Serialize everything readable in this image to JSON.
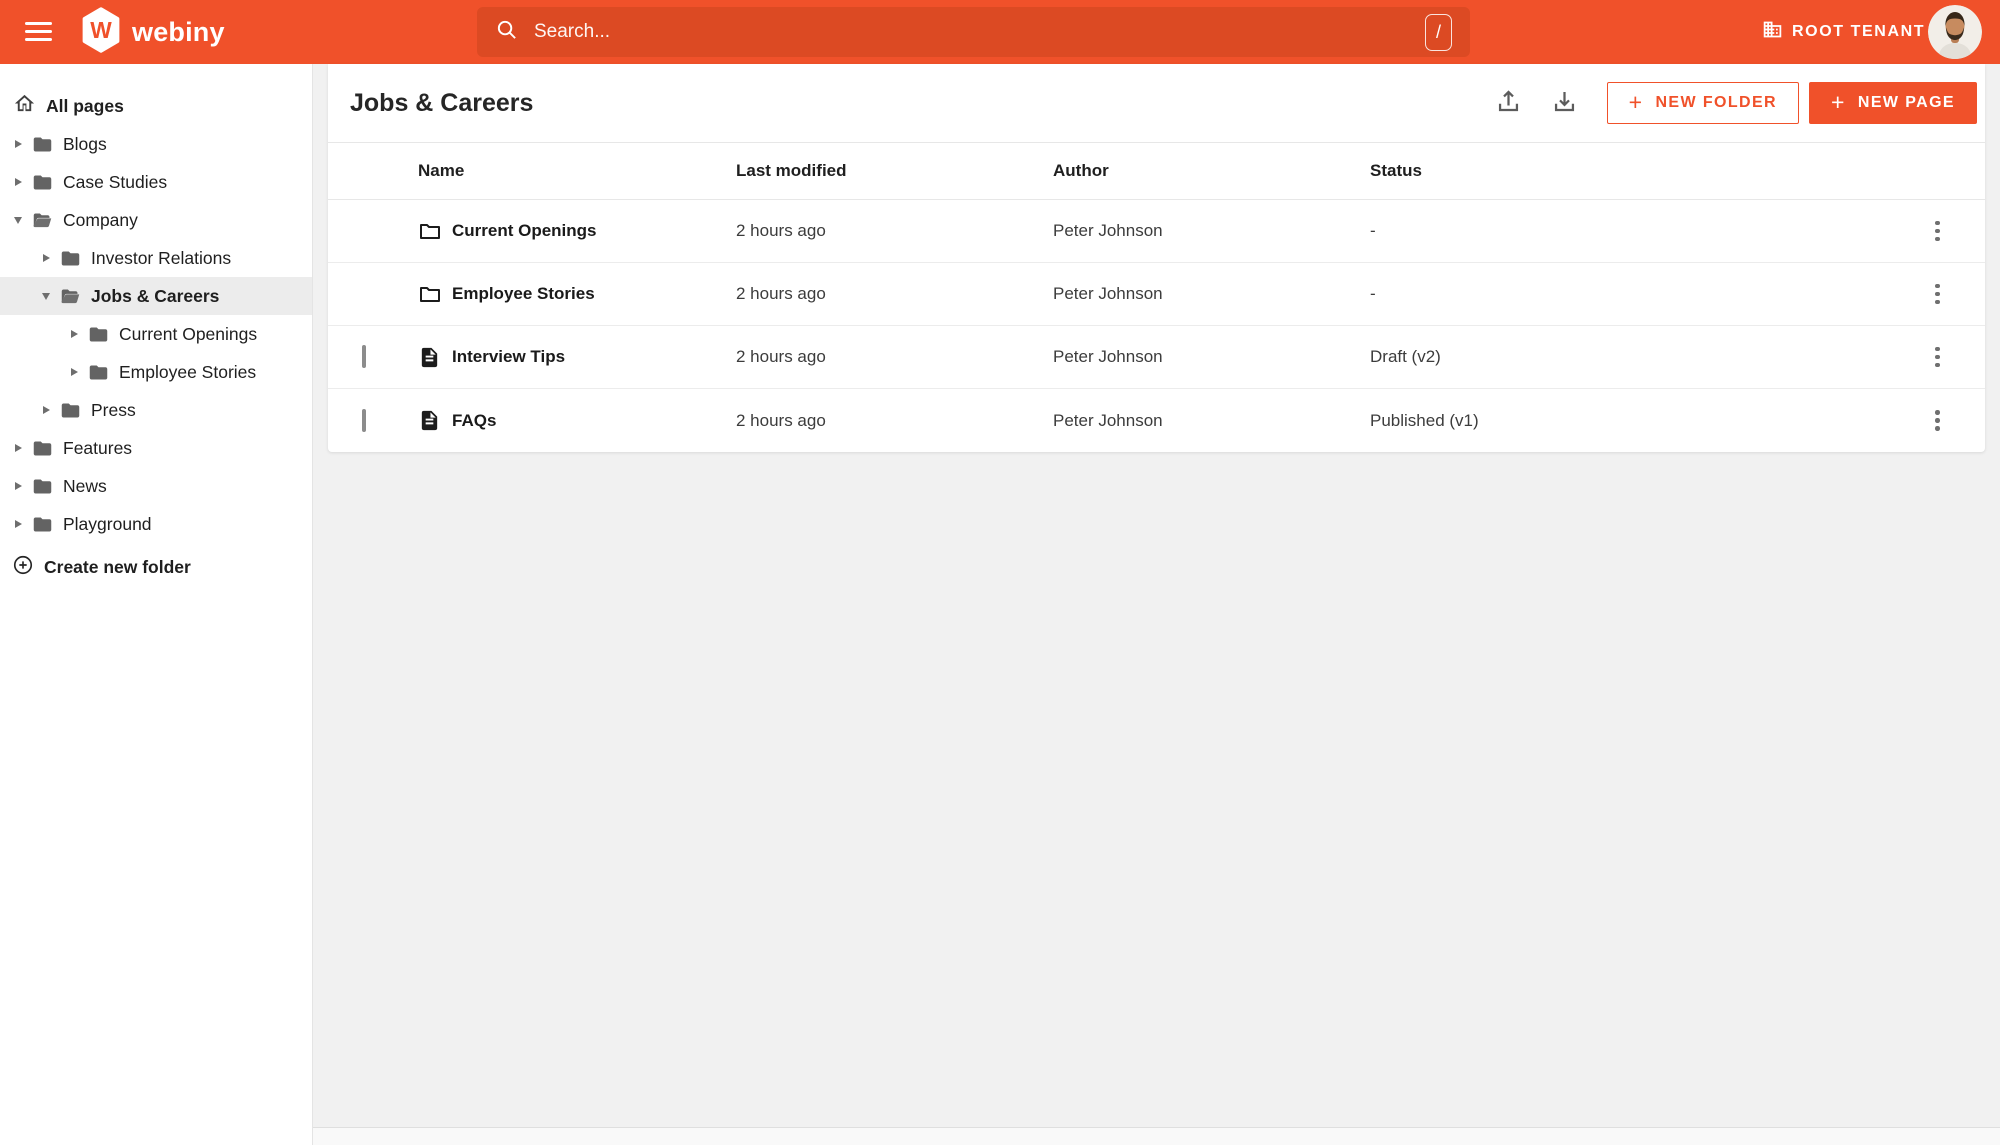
{
  "topbar": {
    "brand": "webiny",
    "brand_initial": "W",
    "tenant": "ROOT TENANT",
    "search": {
      "placeholder": "Search...",
      "shortcut": "/"
    }
  },
  "sidebar": {
    "root_label": "All pages",
    "items": [
      {
        "label": "Blogs",
        "level": 1,
        "state": "collapsed",
        "selected": false
      },
      {
        "label": "Case Studies",
        "level": 1,
        "state": "collapsed",
        "selected": false
      },
      {
        "label": "Company",
        "level": 1,
        "state": "expanded",
        "selected": false
      },
      {
        "label": "Investor Relations",
        "level": 2,
        "state": "collapsed",
        "selected": false
      },
      {
        "label": "Jobs & Careers",
        "level": 2,
        "state": "expanded",
        "selected": true
      },
      {
        "label": "Current Openings",
        "level": 3,
        "state": "collapsed",
        "selected": false
      },
      {
        "label": "Employee Stories",
        "level": 3,
        "state": "collapsed",
        "selected": false
      },
      {
        "label": "Press",
        "level": 2,
        "state": "collapsed",
        "selected": false
      },
      {
        "label": "Features",
        "level": 1,
        "state": "collapsed",
        "selected": false
      },
      {
        "label": "News",
        "level": 1,
        "state": "collapsed",
        "selected": false
      },
      {
        "label": "Playground",
        "level": 1,
        "state": "collapsed",
        "selected": false
      }
    ],
    "create_folder_label": "Create new folder"
  },
  "main": {
    "title": "Jobs & Careers",
    "actions": {
      "new_folder": "NEW FOLDER",
      "new_page": "NEW PAGE",
      "plus": "+"
    },
    "table": {
      "headers": {
        "name": "Name",
        "modified": "Last modified",
        "author": "Author",
        "status": "Status"
      },
      "rows": [
        {
          "type": "folder",
          "name": "Current Openings",
          "modified": "2 hours ago",
          "author": "Peter Johnson",
          "status": "-"
        },
        {
          "type": "folder",
          "name": "Employee Stories",
          "modified": "2 hours ago",
          "author": "Peter Johnson",
          "status": "-"
        },
        {
          "type": "page",
          "name": "Interview Tips",
          "modified": "2 hours ago",
          "author": "Peter Johnson",
          "status": "Draft (v2)"
        },
        {
          "type": "page",
          "name": "FAQs",
          "modified": "2 hours ago",
          "author": "Peter Johnson",
          "status": "Published (v1)"
        }
      ]
    }
  },
  "colors": {
    "brand_orange": "#F0512A",
    "search_field": "#DC4A23",
    "checkbox_teal": "#00CCB0",
    "sidebar_selected": "#ECECEC"
  }
}
